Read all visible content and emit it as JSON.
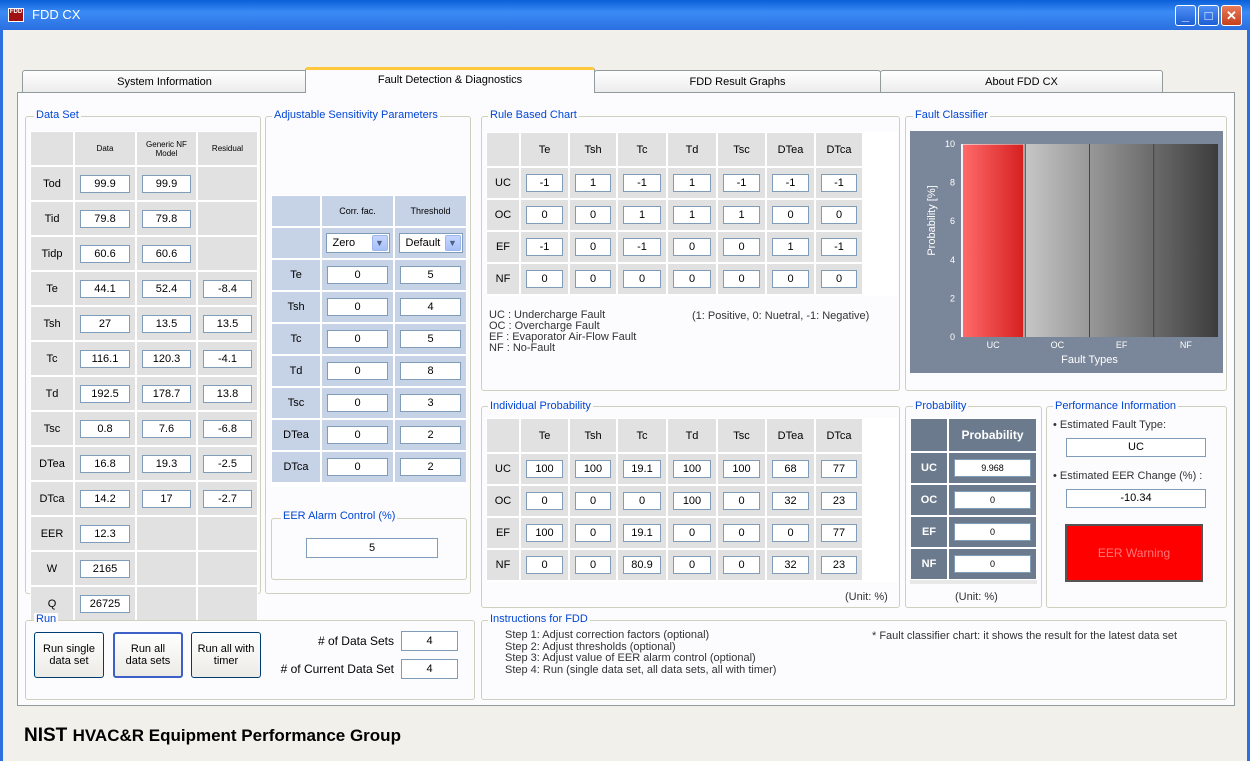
{
  "window": {
    "title": "FDD CX",
    "icon_text": "FDD"
  },
  "tabs": [
    "System Information",
    "Fault Detection & Diagnostics",
    "FDD Result Graphs",
    "About FDD CX"
  ],
  "dataset": {
    "title": "Data Set",
    "headers": [
      "Data",
      "Generic NF Model",
      "Residual"
    ],
    "rows": [
      {
        "label": "Tod",
        "data": "99.9",
        "model": "99.9",
        "residual": ""
      },
      {
        "label": "Tid",
        "data": "79.8",
        "model": "79.8",
        "residual": ""
      },
      {
        "label": "Tidp",
        "data": "60.6",
        "model": "60.6",
        "residual": ""
      },
      {
        "label": "Te",
        "data": "44.1",
        "model": "52.4",
        "residual": "-8.4"
      },
      {
        "label": "Tsh",
        "data": "27",
        "model": "13.5",
        "residual": "13.5"
      },
      {
        "label": "Tc",
        "data": "116.1",
        "model": "120.3",
        "residual": "-4.1"
      },
      {
        "label": "Td",
        "data": "192.5",
        "model": "178.7",
        "residual": "13.8"
      },
      {
        "label": "Tsc",
        "data": "0.8",
        "model": "7.6",
        "residual": "-6.8"
      },
      {
        "label": "DTea",
        "data": "16.8",
        "model": "19.3",
        "residual": "-2.5"
      },
      {
        "label": "DTca",
        "data": "14.2",
        "model": "17",
        "residual": "-2.7"
      },
      {
        "label": "EER",
        "data": "12.3",
        "model": "",
        "residual": ""
      },
      {
        "label": "W",
        "data": "2165",
        "model": "",
        "residual": ""
      },
      {
        "label": "Q",
        "data": "26725",
        "model": "",
        "residual": ""
      }
    ]
  },
  "sensitivity": {
    "title": "Adjustable Sensitivity Parameters",
    "headers": [
      "Corr. fac.",
      "Threshold"
    ],
    "corr_select": "Zero",
    "threshold_select": "Default",
    "rows": [
      {
        "label": "Te",
        "corr": "0",
        "thr": "5"
      },
      {
        "label": "Tsh",
        "corr": "0",
        "thr": "4"
      },
      {
        "label": "Tc",
        "corr": "0",
        "thr": "5"
      },
      {
        "label": "Td",
        "corr": "0",
        "thr": "8"
      },
      {
        "label": "Tsc",
        "corr": "0",
        "thr": "3"
      },
      {
        "label": "DTea",
        "corr": "0",
        "thr": "2"
      },
      {
        "label": "DTca",
        "corr": "0",
        "thr": "2"
      }
    ]
  },
  "eer_alarm": {
    "title": "EER Alarm Control (%)",
    "value": "5"
  },
  "rule_chart": {
    "title": "Rule Based Chart",
    "cols": [
      "Te",
      "Tsh",
      "Tc",
      "Td",
      "Tsc",
      "DTea",
      "DTca"
    ],
    "rows": [
      {
        "label": "UC",
        "vals": [
          "-1",
          "1",
          "-1",
          "1",
          "-1",
          "-1",
          "-1"
        ]
      },
      {
        "label": "OC",
        "vals": [
          "0",
          "0",
          "1",
          "1",
          "1",
          "0",
          "0"
        ]
      },
      {
        "label": "EF",
        "vals": [
          "-1",
          "0",
          "-1",
          "0",
          "0",
          "1",
          "-1"
        ]
      },
      {
        "label": "NF",
        "vals": [
          "0",
          "0",
          "0",
          "0",
          "0",
          "0",
          "0"
        ]
      }
    ],
    "legend": [
      "UC : Undercharge Fault",
      "OC : Overcharge Fault",
      "EF : Evaporator Air-Flow Fault",
      "NF : No-Fault"
    ],
    "note": "(1: Positive, 0: Nuetral, -1: Negative)"
  },
  "individual": {
    "title": "Individual Probability",
    "cols": [
      "Te",
      "Tsh",
      "Tc",
      "Td",
      "Tsc",
      "DTea",
      "DTca"
    ],
    "rows": [
      {
        "label": "UC",
        "vals": [
          "100",
          "100",
          "19.1",
          "100",
          "100",
          "68",
          "77"
        ]
      },
      {
        "label": "OC",
        "vals": [
          "0",
          "0",
          "0",
          "100",
          "0",
          "32",
          "23"
        ]
      },
      {
        "label": "EF",
        "vals": [
          "100",
          "0",
          "19.1",
          "0",
          "0",
          "0",
          "77"
        ]
      },
      {
        "label": "NF",
        "vals": [
          "0",
          "0",
          "80.9",
          "0",
          "0",
          "32",
          "23"
        ]
      }
    ],
    "unit": "(Unit: %)"
  },
  "classifier": {
    "title": "Fault Classifier",
    "ylabel": "Probability [%]",
    "xlabel": "Fault Types"
  },
  "chart_data": {
    "type": "bar",
    "categories": [
      "UC",
      "OC",
      "EF",
      "NF"
    ],
    "values": [
      9.968,
      0,
      0,
      0
    ],
    "ylim": [
      0,
      10
    ],
    "yticks": [
      "0",
      "2",
      "4",
      "6",
      "8",
      "10"
    ],
    "xlabel": "Fault Types",
    "ylabel": "Probability [%]",
    "bar_color": "#e83a3a"
  },
  "probability": {
    "title": "Probability",
    "header": "Probability",
    "rows": [
      {
        "label": "UC",
        "val": "9.968"
      },
      {
        "label": "OC",
        "val": "0"
      },
      {
        "label": "EF",
        "val": "0"
      },
      {
        "label": "NF",
        "val": "0"
      }
    ],
    "unit": "(Unit: %)"
  },
  "performance": {
    "title": "Performance Information",
    "fault_type_label": "• Estimated Fault Type:",
    "fault_type": "UC",
    "eer_change_label": "• Estimated EER Change (%) :",
    "eer_change": "-10.34",
    "warning": "EER Warning",
    "warning_color": "#ff0000"
  },
  "run": {
    "title": "Run",
    "btn_single": "Run single data set",
    "btn_all": "Run all data sets",
    "btn_timer": "Run all with timer",
    "num_sets_label": "# of Data Sets",
    "num_sets": "4",
    "cur_set_label": "# of Current Data Set",
    "cur_set": "4"
  },
  "instructions": {
    "title": "Instructions for FDD",
    "steps": [
      "Step 1: Adjust correction factors (optional)",
      "Step 2: Adjust  thresholds (optional)",
      "Step 3: Adjust value of EER alarm control (optional)",
      "Step 4: Run (single data set, all data sets, all with timer)"
    ],
    "note": "* Fault classifier chart: it shows the result for the latest data set"
  },
  "footer": {
    "org": "NIST",
    "group": "HVAC&R Equipment Performance Group"
  }
}
